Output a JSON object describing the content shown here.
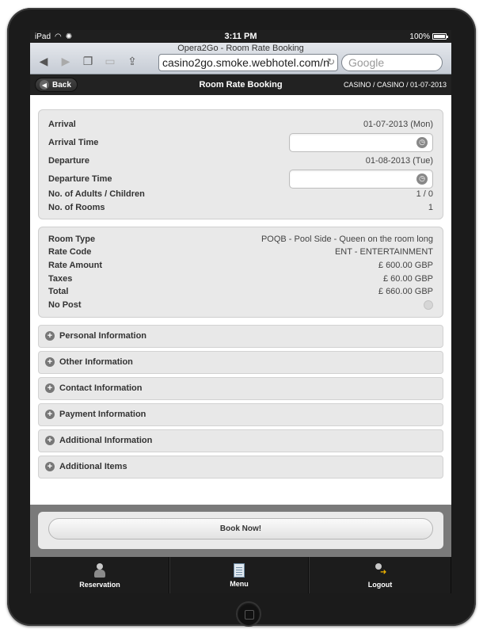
{
  "status_bar": {
    "device": "iPad",
    "time": "3:11 PM",
    "battery": "100%"
  },
  "browser": {
    "page_title": "Opera2Go - Room Rate Booking",
    "url": "casino2go.smoke.webhotel.com/n",
    "search_placeholder": "Google"
  },
  "header": {
    "back_label": "Back",
    "title": "Room Rate Booking",
    "breadcrumb": "CASINO / CASINO / 01-07-2013"
  },
  "stay": {
    "arrival_label": "Arrival",
    "arrival_value": "01-07-2013 (Mon)",
    "arrival_time_label": "Arrival Time",
    "departure_label": "Departure",
    "departure_value": "01-08-2013 (Tue)",
    "departure_time_label": "Departure Time",
    "adults_label": "No. of Adults / Children",
    "adults_value": "1 / 0",
    "rooms_label": "No. of Rooms",
    "rooms_value": "1"
  },
  "rate": {
    "room_type_label": "Room Type",
    "room_type_value": "POQB - Pool Side - Queen on the room long",
    "rate_code_label": "Rate Code",
    "rate_code_value": "ENT - ENTERTAINMENT",
    "rate_amount_label": "Rate Amount",
    "rate_amount_value": "£ 600.00 GBP",
    "taxes_label": "Taxes",
    "taxes_value": "£ 60.00 GBP",
    "total_label": "Total",
    "total_value": "£ 660.00 GBP",
    "no_post_label": "No Post"
  },
  "sections": [
    "Personal Information",
    "Other Information",
    "Contact Information",
    "Payment Information",
    "Additional Information",
    "Additional Items"
  ],
  "book_label": "Book Now!",
  "nav": [
    {
      "label": "Reservation",
      "icon": "reservation-icon"
    },
    {
      "label": "Menu",
      "icon": "menu-icon"
    },
    {
      "label": "Logout",
      "icon": "logout-icon"
    }
  ]
}
